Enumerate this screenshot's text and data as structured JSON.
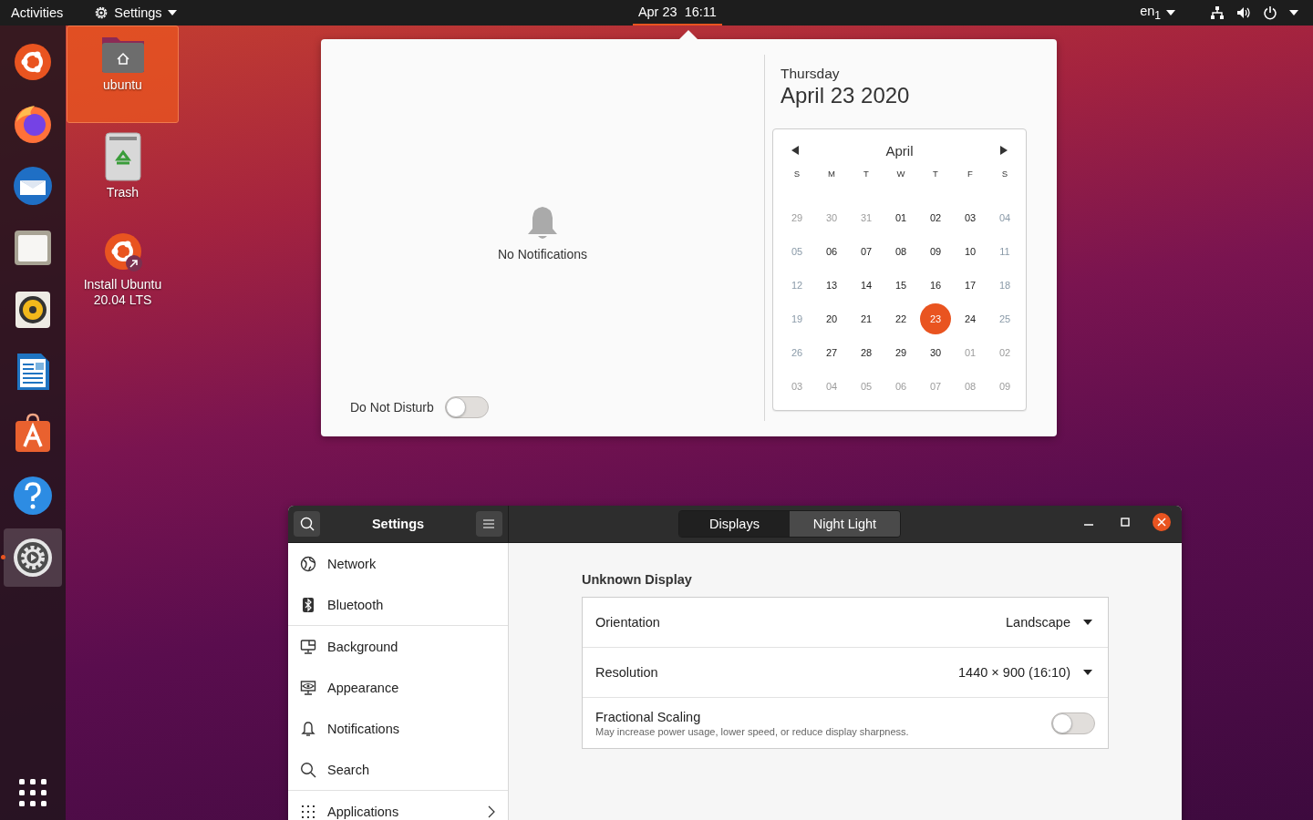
{
  "top_bar": {
    "activities": "Activities",
    "app_menu": "Settings",
    "clock": "Apr 23  16:11",
    "keyboard_layout": "en$_{1}$"
  },
  "dock": {
    "items": [
      {
        "kind": "installer",
        "running": false
      },
      {
        "kind": "browser",
        "running": false
      },
      {
        "kind": "mail",
        "running": false
      },
      {
        "kind": "files",
        "running": false
      },
      {
        "kind": "music",
        "running": false
      },
      {
        "kind": "writer",
        "running": false
      },
      {
        "kind": "store",
        "running": false
      },
      {
        "kind": "help",
        "running": false
      },
      {
        "kind": "settings",
        "running": true
      }
    ]
  },
  "desktop_icons": [
    {
      "kind": "home",
      "label": "ubuntu",
      "selected": true
    },
    {
      "kind": "trash",
      "label": "Trash",
      "selected": false
    },
    {
      "kind": "installer",
      "label": "Install Ubuntu 20.04 LTS",
      "selected": false
    }
  ],
  "notification_popup": {
    "empty_message": "No Notifications",
    "do_not_disturb": {
      "label": "Do Not Disturb",
      "on": false
    },
    "day": "Thursday",
    "date": "April 23 2020",
    "calendar": {
      "month": "April",
      "weekdays": [
        "S",
        "M",
        "T",
        "W",
        "T",
        "F",
        "S"
      ],
      "weeks": [
        [
          {
            "text": "29",
            "kind": "other",
            "selected": false
          },
          {
            "text": "30",
            "kind": "other",
            "selected": false
          },
          {
            "text": "31",
            "kind": "other",
            "selected": false
          },
          {
            "text": "01",
            "kind": "weekday",
            "selected": false
          },
          {
            "text": "02",
            "kind": "weekday",
            "selected": false
          },
          {
            "text": "03",
            "kind": "weekday",
            "selected": false
          },
          {
            "text": "04",
            "kind": "weekend",
            "selected": false
          }
        ],
        [
          {
            "text": "05",
            "kind": "weekend",
            "selected": false
          },
          {
            "text": "06",
            "kind": "weekday",
            "selected": false
          },
          {
            "text": "07",
            "kind": "weekday",
            "selected": false
          },
          {
            "text": "08",
            "kind": "weekday",
            "selected": false
          },
          {
            "text": "09",
            "kind": "weekday",
            "selected": false
          },
          {
            "text": "10",
            "kind": "weekday",
            "selected": false
          },
          {
            "text": "11",
            "kind": "weekend",
            "selected": false
          }
        ],
        [
          {
            "text": "12",
            "kind": "weekend",
            "selected": false
          },
          {
            "text": "13",
            "kind": "weekday",
            "selected": false
          },
          {
            "text": "14",
            "kind": "weekday",
            "selected": false
          },
          {
            "text": "15",
            "kind": "weekday",
            "selected": false
          },
          {
            "text": "16",
            "kind": "weekday",
            "selected": false
          },
          {
            "text": "17",
            "kind": "weekday",
            "selected": false
          },
          {
            "text": "18",
            "kind": "weekend",
            "selected": false
          }
        ],
        [
          {
            "text": "19",
            "kind": "weekend",
            "selected": false
          },
          {
            "text": "20",
            "kind": "weekday",
            "selected": false
          },
          {
            "text": "21",
            "kind": "weekday",
            "selected": false
          },
          {
            "text": "22",
            "kind": "weekday",
            "selected": false
          },
          {
            "text": "23",
            "kind": "weekday",
            "selected": true
          },
          {
            "text": "24",
            "kind": "weekday",
            "selected": false
          },
          {
            "text": "25",
            "kind": "weekend",
            "selected": false
          }
        ],
        [
          {
            "text": "26",
            "kind": "weekend",
            "selected": false
          },
          {
            "text": "27",
            "kind": "weekday",
            "selected": false
          },
          {
            "text": "28",
            "kind": "weekday",
            "selected": false
          },
          {
            "text": "29",
            "kind": "weekday",
            "selected": false
          },
          {
            "text": "30",
            "kind": "weekday",
            "selected": false
          },
          {
            "text": "01",
            "kind": "other",
            "selected": false
          },
          {
            "text": "02",
            "kind": "other",
            "selected": false
          }
        ],
        [
          {
            "text": "03",
            "kind": "other",
            "selected": false
          },
          {
            "text": "04",
            "kind": "other",
            "selected": false
          },
          {
            "text": "05",
            "kind": "other",
            "selected": false
          },
          {
            "text": "06",
            "kind": "other",
            "selected": false
          },
          {
            "text": "07",
            "kind": "other",
            "selected": false
          },
          {
            "text": "08",
            "kind": "other",
            "selected": false
          },
          {
            "text": "09",
            "kind": "other",
            "selected": false
          }
        ]
      ]
    }
  },
  "settings_window": {
    "title": "Settings",
    "tabs": [
      {
        "label": "Displays",
        "selected": true
      },
      {
        "label": "Night Light",
        "selected": false
      }
    ],
    "sidebar": {
      "groups": [
        [
          {
            "label": "Network",
            "kind": "globe",
            "submenu": false,
            "selected": false
          },
          {
            "label": "Bluetooth",
            "kind": "bluetooth",
            "submenu": false,
            "selected": false
          }
        ],
        [
          {
            "label": "Background",
            "kind": "monitor",
            "submenu": false,
            "selected": false
          },
          {
            "label": "Appearance",
            "kind": "appearance",
            "submenu": false,
            "selected": false
          },
          {
            "label": "Notifications",
            "kind": "bell",
            "submenu": false,
            "selected": false
          },
          {
            "label": "Search",
            "kind": "search",
            "submenu": false,
            "selected": false
          }
        ],
        [
          {
            "label": "Applications",
            "kind": "grid",
            "submenu": true,
            "selected": false
          }
        ]
      ]
    },
    "section_title": "Unknown Display",
    "rows": [
      {
        "kind": "dropdown",
        "label": "Orientation",
        "value": "Landscape"
      },
      {
        "kind": "dropdown",
        "label": "Resolution",
        "value": "1440 × 900 (16:10)"
      },
      {
        "kind": "switch",
        "label": "Fractional Scaling",
        "description": "May increase power usage, lower speed, or reduce display sharpness.",
        "on": false
      }
    ]
  }
}
